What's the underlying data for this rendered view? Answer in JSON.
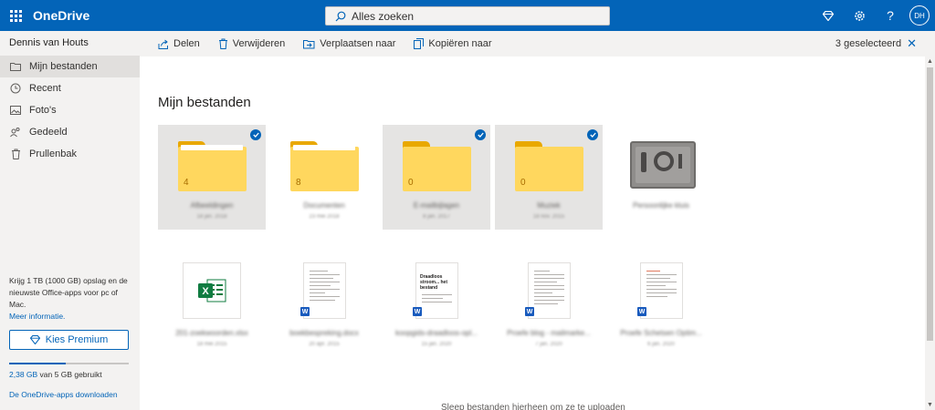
{
  "app": {
    "name": "OneDrive"
  },
  "search": {
    "placeholder": "Alles zoeken"
  },
  "header": {
    "avatar_initials": "DH"
  },
  "sidebar": {
    "user_name": "Dennis van Houts",
    "items": [
      {
        "label": "Mijn bestanden",
        "icon": "folder-icon",
        "active": true
      },
      {
        "label": "Recent",
        "icon": "clock-icon"
      },
      {
        "label": "Foto's",
        "icon": "photo-icon"
      },
      {
        "label": "Gedeeld",
        "icon": "people-icon"
      },
      {
        "label": "Prullenbak",
        "icon": "trash-icon"
      }
    ],
    "promo_text": "Krijg 1 TB (1000 GB) opslag en de nieuwste Office-apps voor pc of Mac.",
    "promo_link": "Meer informatie.",
    "premium_button": "Kies Premium",
    "storage_used": "2,38 GB",
    "storage_rest": " van 5 GB gebruikt",
    "storage_fraction": 0.476,
    "apps_link": "De OneDrive-apps downloaden"
  },
  "toolbar": {
    "share": "Delen",
    "delete": "Verwijderen",
    "move": "Verplaatsen naar",
    "copy": "Kopiëren naar",
    "selected": "3 geselecteerd"
  },
  "main": {
    "title": "Mijn bestanden",
    "folders": [
      {
        "name": "Afbeeldingen",
        "date": "18 jan. 2018",
        "count": "4",
        "selected": true
      },
      {
        "name": "Documenten",
        "date": "23 mei 2018",
        "count": "8",
        "selected": false
      },
      {
        "name": "E-mailbijlagen",
        "date": "8 jan. 2017",
        "count": "0",
        "selected": true
      },
      {
        "name": "Muziek",
        "date": "18 nov. 2015",
        "count": "0",
        "selected": true
      }
    ],
    "vault": {
      "name": "Persoonlijke kluis"
    },
    "files": [
      {
        "name": "201-zoekwoorden.xlsx",
        "date": "18 mei 2015",
        "type": "excel"
      },
      {
        "name": "boekbespreking.docx",
        "date": "20 apr. 2015",
        "type": "word"
      },
      {
        "name": "koopgids-draadloos-opl...",
        "date": "15 jan. 2020",
        "type": "word"
      },
      {
        "name": "Proefe blog - mailmarke...",
        "date": "7 jan. 2020",
        "type": "word"
      },
      {
        "name": "Proefe Schetsen Optim...",
        "date": "6 jan. 2020",
        "type": "word"
      }
    ],
    "doc_preview_title": "Draadloos stroom... het bestand",
    "drop_hint": "Sleep bestanden hierheen om ze te uploaden"
  },
  "colors": {
    "accent": "#0364b8",
    "folder": "#ffd75e",
    "excel": "#107c41",
    "word": "#185abd"
  }
}
